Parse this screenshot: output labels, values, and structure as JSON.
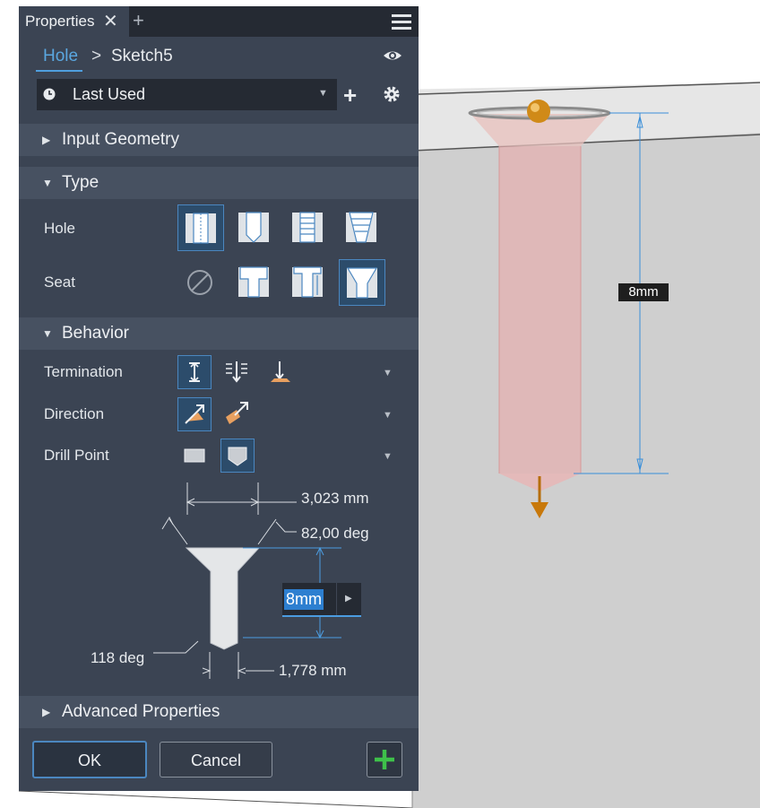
{
  "panel": {
    "tab_title": "Properties",
    "tab_close": "✕",
    "tab_add": "+",
    "breadcrumb": {
      "feature": "Hole",
      "separator": ">",
      "sketch": "Sketch5"
    },
    "preset": {
      "value": "Last Used",
      "add": "+"
    },
    "sections": {
      "input_geometry": "Input Geometry",
      "type": "Type",
      "behavior": "Behavior",
      "advanced": "Advanced Properties"
    },
    "type": {
      "hole_label": "Hole",
      "seat_label": "Seat"
    },
    "behavior": {
      "termination_label": "Termination",
      "direction_label": "Direction",
      "drill_point_label": "Drill Point"
    },
    "diagram": {
      "diameter": "3,023 mm",
      "csk_angle": "82,00 deg",
      "drill_angle": "118 deg",
      "drill_diameter": "1,778 mm",
      "depth_value": "8mm"
    },
    "buttons": {
      "ok": "OK",
      "cancel": "Cancel"
    }
  },
  "viewport": {
    "depth_annotation": "8mm"
  },
  "colors": {
    "panel_bg": "#3b4453",
    "section_bg": "#475161",
    "accent": "#4b9ce0",
    "apply_green": "#3ec04a",
    "hole_preview": "#e8b4b4",
    "orange_handle": "#c8780a"
  }
}
